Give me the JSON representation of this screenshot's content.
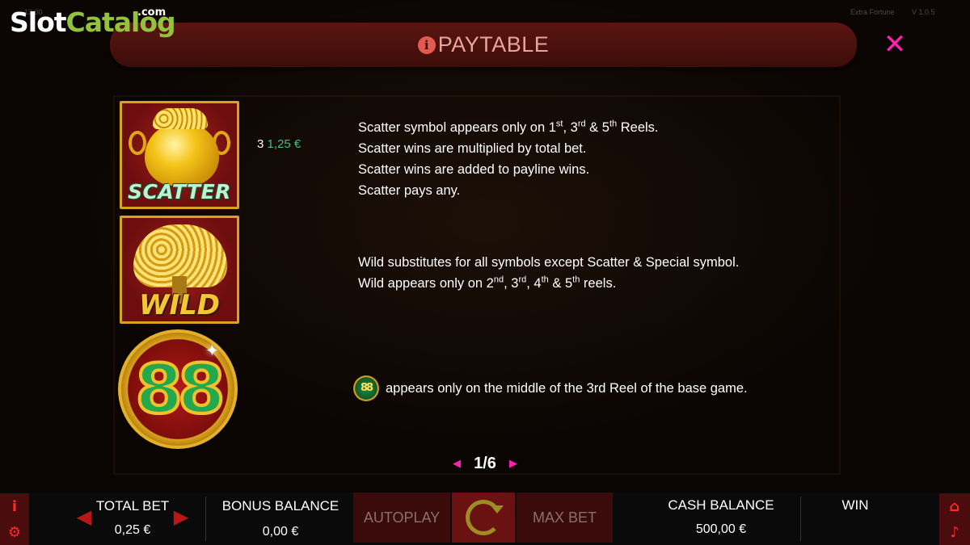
{
  "watermark": {
    "brand_part1": "Slot",
    "brand_part2": "Catalog",
    "suffix": ".com"
  },
  "top_meta": {
    "time": "13:00",
    "game": "Extra Fortune",
    "version": "V 1.0.5"
  },
  "paytable": {
    "title": "PAYTABLE",
    "scatter": {
      "symbol_label": "SCATTER",
      "pay_count": "3",
      "pay_amount": "1,25 €",
      "lines": [
        {
          "before": "Scatter symbol appears only on 1",
          "sup1": "st",
          "mid1": ", 3",
          "sup2": "rd",
          "mid2": " & 5",
          "sup3": "th",
          "after": " Reels."
        },
        "Scatter wins are multiplied by total bet.",
        "Scatter wins are added to payline wins.",
        "Scatter pays any."
      ]
    },
    "wild": {
      "symbol_label": "WILD",
      "line1": "Wild substitutes for all symbols except Scatter & Special symbol.",
      "line2": {
        "before": "Wild appears only on 2",
        "sup1": "nd",
        "mid1": ", 3",
        "sup2": "rd",
        "mid2": ", 4",
        "sup3": "th",
        "mid3": " & 5",
        "sup4": "th",
        "after": " reels."
      }
    },
    "special": {
      "symbol_label": "88",
      "text": "appears only on the middle of the 3rd Reel of the base game."
    },
    "pager": {
      "page": "1/6"
    }
  },
  "bottom_bar": {
    "total_bet_label": "TOTAL BET",
    "total_bet_value": "0,25 €",
    "bonus_balance_label": "BONUS BALANCE",
    "bonus_balance_value": "0,00 €",
    "autoplay_label": "AUTOPLAY",
    "max_bet_label": "MAX BET",
    "cash_balance_label": "CASH BALANCE",
    "cash_balance_value": "500,00 €",
    "win_label": "WIN"
  },
  "colors": {
    "accent_pink": "#ff1fb4",
    "header_bg": "#4a110c",
    "win_green": "#43c07a",
    "bar_red": "#6a1212"
  }
}
